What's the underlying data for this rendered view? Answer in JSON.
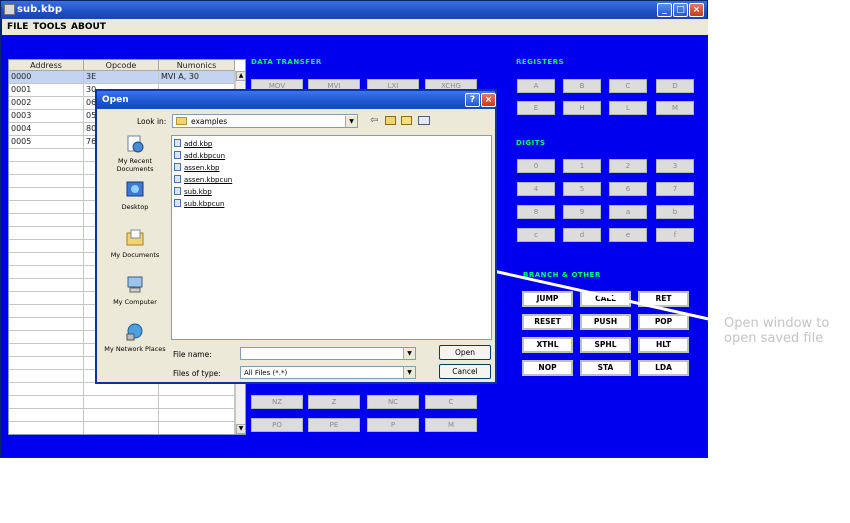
{
  "window": {
    "title": "sub.kbp"
  },
  "menu": [
    "FILE",
    "TOOLS",
    "ABOUT"
  ],
  "table": {
    "headers": [
      "Address",
      "Opcode",
      "Numonics"
    ],
    "rows": [
      {
        "address": "0000",
        "opcode": "3E",
        "mnemonic": "MVI  A,  30"
      },
      {
        "address": "0001",
        "opcode": "30",
        "mnemonic": ""
      },
      {
        "address": "0002",
        "opcode": "06",
        "mnemonic": ""
      },
      {
        "address": "0003",
        "opcode": "05",
        "mnemonic": ""
      },
      {
        "address": "0004",
        "opcode": "80",
        "mnemonic": ""
      },
      {
        "address": "0005",
        "opcode": "76",
        "mnemonic": ""
      }
    ],
    "selected_row": 0
  },
  "data_transfer": {
    "label": "DATA TRANSFER",
    "top_buttons": [
      "MOV",
      "MVI",
      "LXI",
      "XCHG"
    ],
    "bottom_buttons": [
      "NZ",
      "Z",
      "NC",
      "C",
      "PO",
      "PE",
      "P",
      "M"
    ]
  },
  "registers": {
    "label": "REGISTERS",
    "buttons": [
      "A",
      "B",
      "C",
      "D",
      "E",
      "H",
      "L",
      "M"
    ]
  },
  "digits": {
    "label": "DIGITS",
    "buttons": [
      "0",
      "1",
      "2",
      "3",
      "4",
      "5",
      "6",
      "7",
      "8",
      "9",
      "a",
      "b",
      "c",
      "d",
      "e",
      "f"
    ]
  },
  "branch": {
    "label": "BRANCH & OTHER",
    "buttons": [
      "JUMP",
      "CALL",
      "RET",
      "RESET",
      "PUSH",
      "POP",
      "XTHL",
      "SPHL",
      "HLT",
      "NOP",
      "STA",
      "LDA"
    ]
  },
  "dialog": {
    "title": "Open",
    "look_in_label": "Look in:",
    "look_in_value": "examples",
    "places": [
      "My Recent Documents",
      "Desktop",
      "My Documents",
      "My Computer",
      "My Network Places"
    ],
    "files": [
      "add.kbp",
      "add.kbpcun",
      "assen.kbp",
      "assen.kbpcun",
      "sub.kbp",
      "sub.kbpcun"
    ],
    "file_name_label": "File name:",
    "file_name_value": "",
    "file_type_label": "Files of type:",
    "file_type_value": "All Files (*.*)",
    "open_label": "Open",
    "cancel_label": "Cancel"
  },
  "annotation": {
    "text": "Open window to open saved file"
  }
}
